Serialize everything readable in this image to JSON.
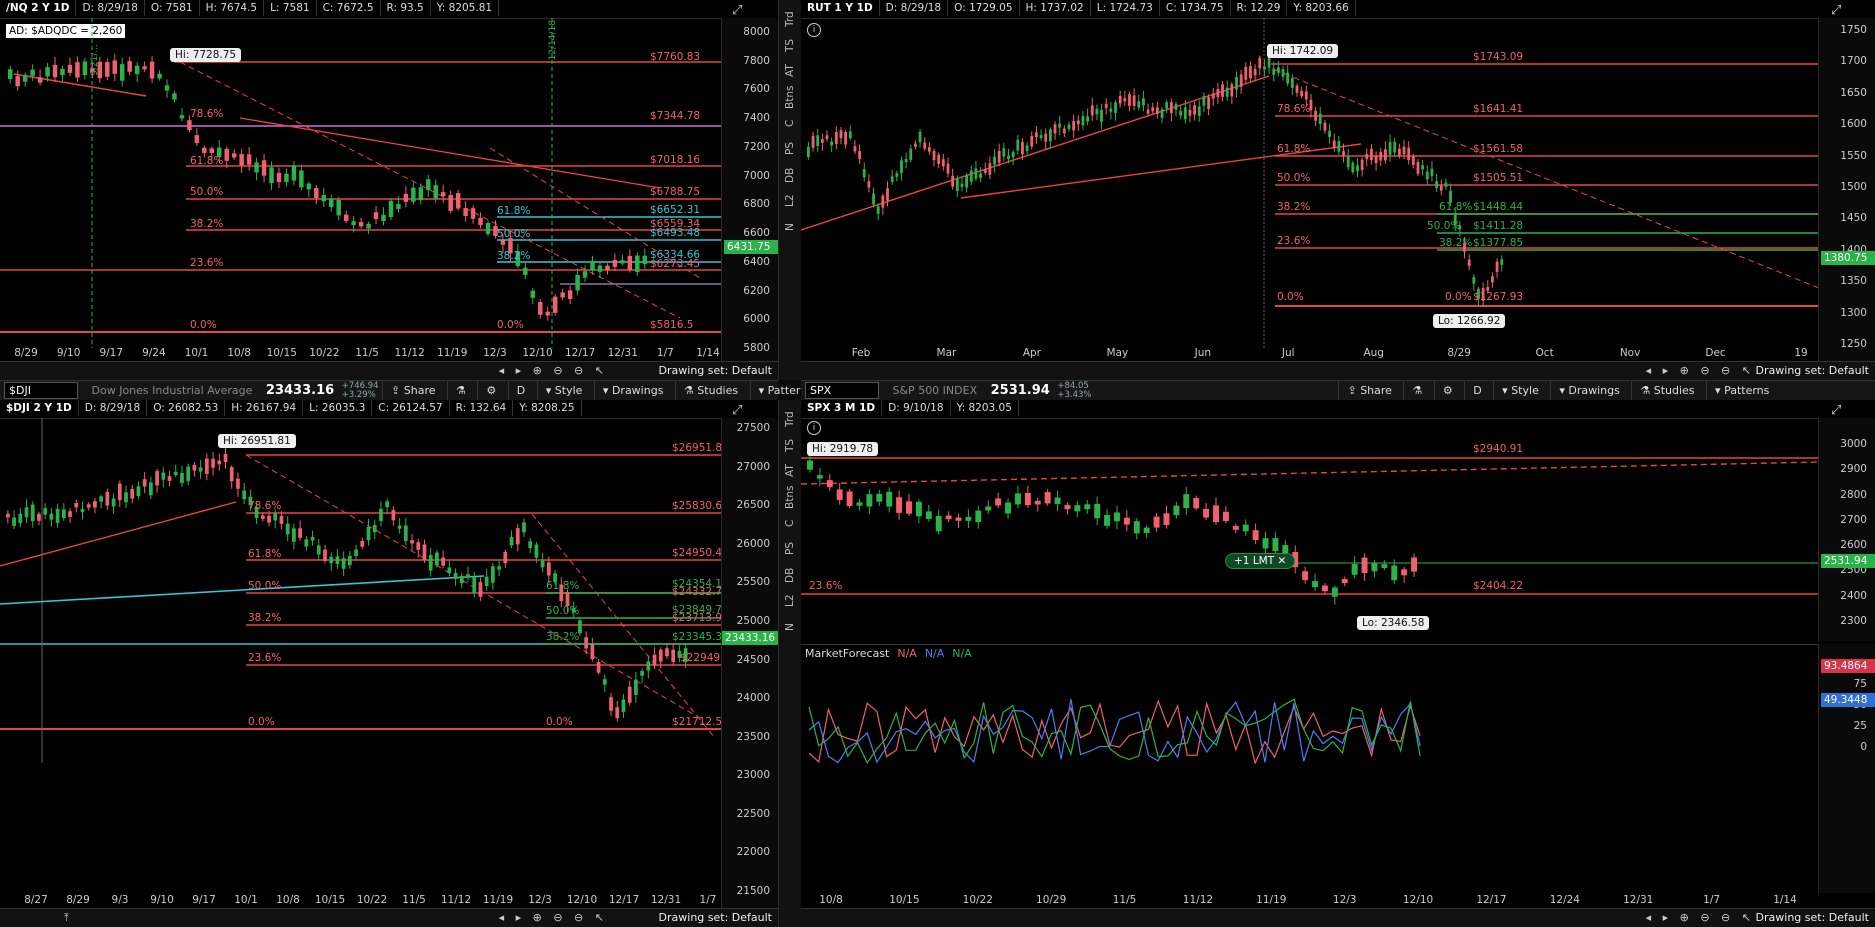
{
  "panes": {
    "nq": {
      "symbol": "/NQ 2 Y 1D",
      "stats": [
        "D: 8/29/18",
        "O: 7581",
        "H: 7674.5",
        "L: 7581",
        "C: 7672.5",
        "R: 93.5",
        "Y: 8205.81"
      ],
      "ad_label": "AD: $ADQDC = 2,260",
      "hi_label": "Hi: 7728.75",
      "last_price": "6431.75",
      "y_ticks": [
        "8000",
        "7800",
        "7600",
        "7400",
        "7200",
        "7000",
        "6800",
        "6600",
        "6400",
        "6200",
        "6000",
        "5800"
      ],
      "x_ticks": [
        "8/29",
        "9/10",
        "9/17",
        "9/24",
        "10/1",
        "10/8",
        "10/15",
        "10/22",
        "11/5",
        "11/12",
        "11/19",
        "12/3",
        "12/10",
        "12/17",
        "12/31",
        "1/7",
        "1/14"
      ],
      "fib_left": [
        "78.6%",
        "61.8%",
        "50.0%",
        "38.2%",
        "23.6%",
        "0.0%"
      ],
      "fib_right": [
        "61.8%",
        "50.0%",
        "38.2%",
        "0.0%"
      ],
      "levels": [
        "$7760.83",
        "$7344.78",
        "$7018.16",
        "$6788.75",
        "$6652.31",
        "$6559.34",
        "$6493.48",
        "$6334.66",
        "$6273.45",
        "$5816.5"
      ],
      "event_label_1": "9/21/...",
      "event_label_2": "12/14/18",
      "drawing_set": "Drawing set: Default"
    },
    "rut": {
      "symbol": "RUT 1 Y 1D",
      "stats": [
        "D: 8/29/18",
        "O: 1729.05",
        "H: 1737.02",
        "L: 1724.73",
        "C: 1734.75",
        "R: 12.29",
        "Y: 8203.66"
      ],
      "hi_label": "Hi: 1742.09",
      "lo_label": "Lo: 1266.92",
      "last_price": "1380.75",
      "y_ticks": [
        "1750",
        "1700",
        "1650",
        "1600",
        "1550",
        "1500",
        "1450",
        "1400",
        "1350",
        "1300",
        "1250"
      ],
      "x_ticks": [
        "Feb",
        "Mar",
        "Apr",
        "May",
        "Jun",
        "Jul",
        "Aug",
        "8/29",
        "Oct",
        "Nov",
        "Dec",
        "19"
      ],
      "fib_left": [
        "78.6%",
        "61.8%",
        "50.0%",
        "38.2%",
        "23.6%",
        "0.0%"
      ],
      "fib_right": [
        "61.8%",
        "50.0%",
        "38.2%",
        "0.0%"
      ],
      "levels": [
        "$1743.09",
        "$1641.41",
        "$1561.58",
        "$1505.51",
        "$1448.44",
        "$1411.28",
        "$1377.85",
        "$1267.93"
      ],
      "drawing_set": "Drawing set: Default"
    },
    "dji": {
      "toolbar_symbol": "$DJI",
      "description": "Dow Jones Industrial Average",
      "price": "23433.16",
      "change": "+746.94",
      "change_pct": "+3.29%",
      "symbol": "$DJI 2 Y 1D",
      "stats": [
        "D: 8/29/18",
        "O: 26082.53",
        "H: 26167.94",
        "L: 26035.3",
        "C: 26124.57",
        "R: 132.64",
        "Y: 8208.25"
      ],
      "hi_label": "Hi: 26951.81",
      "last_price": "23433.16",
      "y_ticks": [
        "27500",
        "27000",
        "26500",
        "26000",
        "25500",
        "25000",
        "24500",
        "24000",
        "23500",
        "23000",
        "22500",
        "22000",
        "21500"
      ],
      "x_ticks": [
        "8/27",
        "8/29",
        "9/3",
        "9/10",
        "9/17",
        "10/1",
        "10/8",
        "10/15",
        "10/22",
        "11/5",
        "11/12",
        "11/19",
        "12/3",
        "12/10",
        "12/17",
        "12/31",
        "1/7"
      ],
      "fib_left": [
        "78.6%",
        "61.8%",
        "50.0%",
        "38.2%",
        "23.6%",
        "0.0%"
      ],
      "fib_right": [
        "61.8%",
        "50.0%",
        "38.2%",
        "0.0%"
      ],
      "levels": [
        "$26951.81",
        "$25830.6",
        "$24950.41",
        "$24354.12",
        "$24332.79",
        "$23849.74",
        "$23713.93",
        "$23345.36",
        "$22949",
        "$21712.53"
      ],
      "drawing_set": "Drawing set: Default"
    },
    "spx": {
      "toolbar_symbol": "SPX",
      "description": "S&P 500 INDEX",
      "price": "2531.94",
      "change": "+84.05",
      "change_pct": "+3.43%",
      "symbol": "SPX 3 M 1D",
      "stats": [
        "D: 9/10/18",
        "Y: 8203.05"
      ],
      "hi_label": "Hi: 2919.78",
      "lo_label": "Lo: 2346.58",
      "order_label": "+1 LMT",
      "last_price": "2531.94",
      "y_ticks": [
        "3000",
        "2900",
        "2800",
        "2700",
        "2600",
        "2500",
        "2400",
        "2300"
      ],
      "x_ticks": [
        "10/8",
        "10/15",
        "10/22",
        "10/29",
        "11/5",
        "11/12",
        "11/19",
        "12/3",
        "12/10",
        "12/17",
        "12/24",
        "12/31",
        "1/7",
        "1/14"
      ],
      "fib_left": [
        "23.6%"
      ],
      "levels": [
        "$2940.91",
        "$2404.22"
      ],
      "study_name": "MarketForecast",
      "study_values": [
        "N/A",
        "N/A",
        "N/A"
      ],
      "study_last": [
        "93.4864",
        "49.3448"
      ],
      "study_ticks": [
        "75",
        "50",
        "25",
        "0"
      ],
      "drawing_set": "Drawing set: Default"
    }
  },
  "toolbar": {
    "share": "Share",
    "period": "D",
    "style": "Style",
    "drawings": "Drawings",
    "studies": "Studies",
    "patterns": "Patterns"
  },
  "sidebar_tabs": [
    "Trd",
    "TS",
    "AT",
    "Btns",
    "C",
    "PS",
    "DB",
    "L2",
    "N"
  ],
  "colors": {
    "up": "#2bb34a",
    "down": "#f0606e",
    "fib": "#e84545",
    "cyan": "#35c6d6",
    "magenta": "#d26be0"
  }
}
